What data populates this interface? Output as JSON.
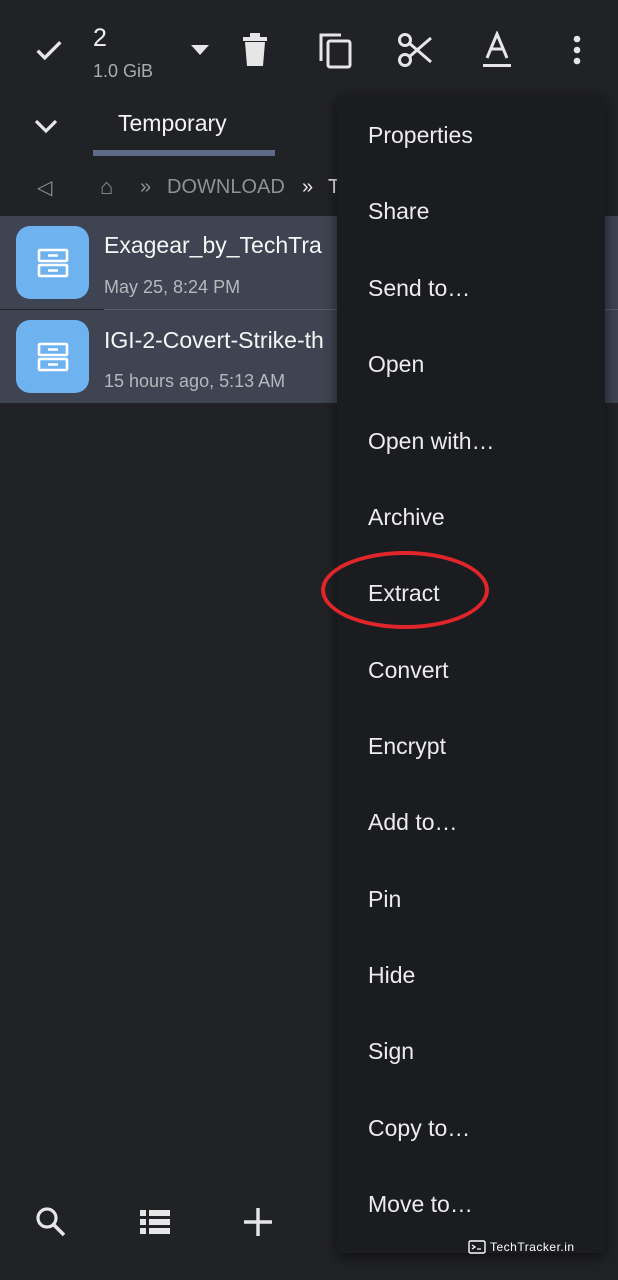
{
  "toolbar": {
    "selected_count": "2",
    "selected_size": "1.0 GiB",
    "icons": [
      "check-icon",
      "dropdown-icon",
      "delete-icon",
      "copy-icon",
      "cut-icon",
      "rename-icon",
      "more-icon"
    ]
  },
  "tabs": {
    "active_label": "Temporary"
  },
  "breadcrumb": {
    "back_glyph": "◁",
    "home_glyph": "⌂",
    "separator": "»",
    "folder": "DOWNLOAD",
    "current_truncated": "T"
  },
  "files": [
    {
      "name": "Exagear_by_TechTra",
      "date": "May 25, 8:24 PM"
    },
    {
      "name": "IGI-2-Covert-Strike-th",
      "date": "15 hours ago, 5:13 AM"
    }
  ],
  "menu": {
    "items": [
      "Properties",
      "Share",
      "Send to…",
      "Open",
      "Open with…",
      "Archive",
      "Extract",
      "Convert",
      "Encrypt",
      "Add to…",
      "Pin",
      "Hide",
      "Sign",
      "Copy to…",
      "Move to…"
    ],
    "highlighted": "Extract",
    "highlight_color": "#e0262b"
  },
  "bottom_bar": {
    "icons": [
      "search-icon",
      "list-view-icon",
      "add-icon"
    ]
  },
  "watermark": {
    "text": "TechTracker.in"
  },
  "colors": {
    "background": "#212226",
    "selected_row": "#3e4451",
    "file_icon": "#6fb2f0",
    "menu_bg": "#1b1c1f",
    "tab_indicator": "#5d6b86"
  }
}
